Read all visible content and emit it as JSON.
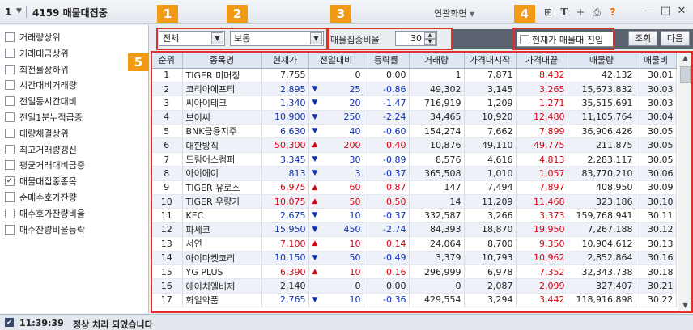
{
  "titlebar": {
    "window_number": "1",
    "screen_title": "4159 매물대집중",
    "related_link": "연관화면",
    "tool_icons": [
      "plus-icon",
      "screen-icon",
      "text-icon",
      "add-icon",
      "print-icon",
      "help-icon"
    ],
    "tool_glyphs": [
      "+",
      "⊞",
      "T",
      "+",
      "⎙",
      "?"
    ]
  },
  "conditions": [
    {
      "label": "거래량상위",
      "checked": false
    },
    {
      "label": "거래대금상위",
      "checked": false
    },
    {
      "label": "회전률상하위",
      "checked": false
    },
    {
      "label": "시간대비거래량",
      "checked": false
    },
    {
      "label": "전일동시간대비",
      "checked": false
    },
    {
      "label": "전일1분누적급증",
      "checked": false
    },
    {
      "label": "대량체결상위",
      "checked": false
    },
    {
      "label": "최고거래량갱신",
      "checked": false
    },
    {
      "label": "평균거래대비급증",
      "checked": false
    },
    {
      "label": "매물대집중종목",
      "checked": true
    },
    {
      "label": "순매수호가잔량",
      "checked": false
    },
    {
      "label": "매수호가잔량비율",
      "checked": false
    },
    {
      "label": "매수잔량비율등락",
      "checked": false
    }
  ],
  "toolbar": {
    "market_select": "전체",
    "type_select": "보통",
    "ratio_label": "매물집중비율",
    "ratio_value": "30",
    "entry_checkbox_label": "현재가 매물대 진입",
    "entry_checked": false,
    "query_button": "조회",
    "next_button": "다음"
  },
  "markers": [
    "1",
    "2",
    "3",
    "4",
    "5"
  ],
  "colors": {
    "up": "#d9000e",
    "down": "#0b2fb5",
    "marker": "#f39a15",
    "highlight": "#e0302a"
  },
  "table": {
    "headers": [
      "순위",
      "종목명",
      "현재가",
      "전일대비",
      "등락률",
      "거래량",
      "가격대시작",
      "가격대끝",
      "매물량",
      "매물비"
    ],
    "rows": [
      {
        "rank": "1",
        "name": "TIGER 미머징",
        "price": "7,755",
        "dir": "none",
        "change": "0",
        "rate": "0.00",
        "volume": "1",
        "start": "7,871",
        "end": "8,432",
        "qty": "42,132",
        "ratio": "30.01"
      },
      {
        "rank": "2",
        "name": "코리아에프티",
        "price": "2,895",
        "dir": "down",
        "change": "25",
        "rate": "-0.86",
        "volume": "49,302",
        "start": "3,145",
        "end": "3,265",
        "qty": "15,673,832",
        "ratio": "30.03"
      },
      {
        "rank": "3",
        "name": "씨아이테크",
        "price": "1,340",
        "dir": "down",
        "change": "20",
        "rate": "-1.47",
        "volume": "716,919",
        "start": "1,209",
        "end": "1,271",
        "qty": "35,515,691",
        "ratio": "30.03"
      },
      {
        "rank": "4",
        "name": "브이씨",
        "price": "10,900",
        "dir": "down",
        "change": "250",
        "rate": "-2.24",
        "volume": "34,465",
        "start": "10,920",
        "end": "12,480",
        "qty": "11,105,764",
        "ratio": "30.04"
      },
      {
        "rank": "5",
        "name": "BNK금융지주",
        "price": "6,630",
        "dir": "down",
        "change": "40",
        "rate": "-0.60",
        "volume": "154,274",
        "start": "7,662",
        "end": "7,899",
        "qty": "36,906,426",
        "ratio": "30.05"
      },
      {
        "rank": "6",
        "name": "대한방직",
        "price": "50,300",
        "dir": "up",
        "change": "200",
        "rate": "0.40",
        "volume": "10,876",
        "start": "49,110",
        "end": "49,775",
        "qty": "211,875",
        "ratio": "30.05"
      },
      {
        "rank": "7",
        "name": "드림어스컴퍼",
        "price": "3,345",
        "dir": "down",
        "change": "30",
        "rate": "-0.89",
        "volume": "8,576",
        "start": "4,616",
        "end": "4,813",
        "qty": "2,283,117",
        "ratio": "30.05"
      },
      {
        "rank": "8",
        "name": "아이에이",
        "price": "813",
        "dir": "down",
        "change": "3",
        "rate": "-0.37",
        "volume": "365,508",
        "start": "1,010",
        "end": "1,057",
        "qty": "83,770,210",
        "ratio": "30.06"
      },
      {
        "rank": "9",
        "name": "TIGER 유로스",
        "price": "6,975",
        "dir": "up",
        "change": "60",
        "rate": "0.87",
        "volume": "147",
        "start": "7,494",
        "end": "7,897",
        "qty": "408,950",
        "ratio": "30.09"
      },
      {
        "rank": "10",
        "name": "TIGER 우량가",
        "price": "10,075",
        "dir": "up",
        "change": "50",
        "rate": "0.50",
        "volume": "14",
        "start": "11,209",
        "end": "11,468",
        "qty": "323,186",
        "ratio": "30.10"
      },
      {
        "rank": "11",
        "name": "KEC",
        "price": "2,675",
        "dir": "down",
        "change": "10",
        "rate": "-0.37",
        "volume": "332,587",
        "start": "3,266",
        "end": "3,373",
        "qty": "159,768,941",
        "ratio": "30.11"
      },
      {
        "rank": "12",
        "name": "파세코",
        "price": "15,950",
        "dir": "down",
        "change": "450",
        "rate": "-2.74",
        "volume": "84,393",
        "start": "18,870",
        "end": "19,950",
        "qty": "7,267,188",
        "ratio": "30.12"
      },
      {
        "rank": "13",
        "name": "서연",
        "price": "7,100",
        "dir": "up",
        "change": "10",
        "rate": "0.14",
        "volume": "24,064",
        "start": "8,700",
        "end": "9,350",
        "qty": "10,904,612",
        "ratio": "30.13"
      },
      {
        "rank": "14",
        "name": "아이마켓코리",
        "price": "10,150",
        "dir": "down",
        "change": "50",
        "rate": "-0.49",
        "volume": "3,379",
        "start": "10,793",
        "end": "10,962",
        "qty": "2,852,864",
        "ratio": "30.16"
      },
      {
        "rank": "15",
        "name": "YG PLUS",
        "price": "6,390",
        "dir": "up",
        "change": "10",
        "rate": "0.16",
        "volume": "296,999",
        "start": "6,978",
        "end": "7,352",
        "qty": "32,343,738",
        "ratio": "30.18"
      },
      {
        "rank": "16",
        "name": "에이치엘비제",
        "price": "2,140",
        "dir": "none",
        "change": "0",
        "rate": "0.00",
        "volume": "0",
        "start": "2,087",
        "end": "2,099",
        "qty": "327,407",
        "ratio": "30.21"
      },
      {
        "rank": "17",
        "name": "화일약품",
        "price": "2,765",
        "dir": "down",
        "change": "10",
        "rate": "-0.36",
        "volume": "429,554",
        "start": "3,294",
        "end": "3,442",
        "qty": "118,916,898",
        "ratio": "30.22"
      }
    ]
  },
  "status": {
    "time": "11:39:39",
    "message": "정상 처리 되었습니다"
  }
}
